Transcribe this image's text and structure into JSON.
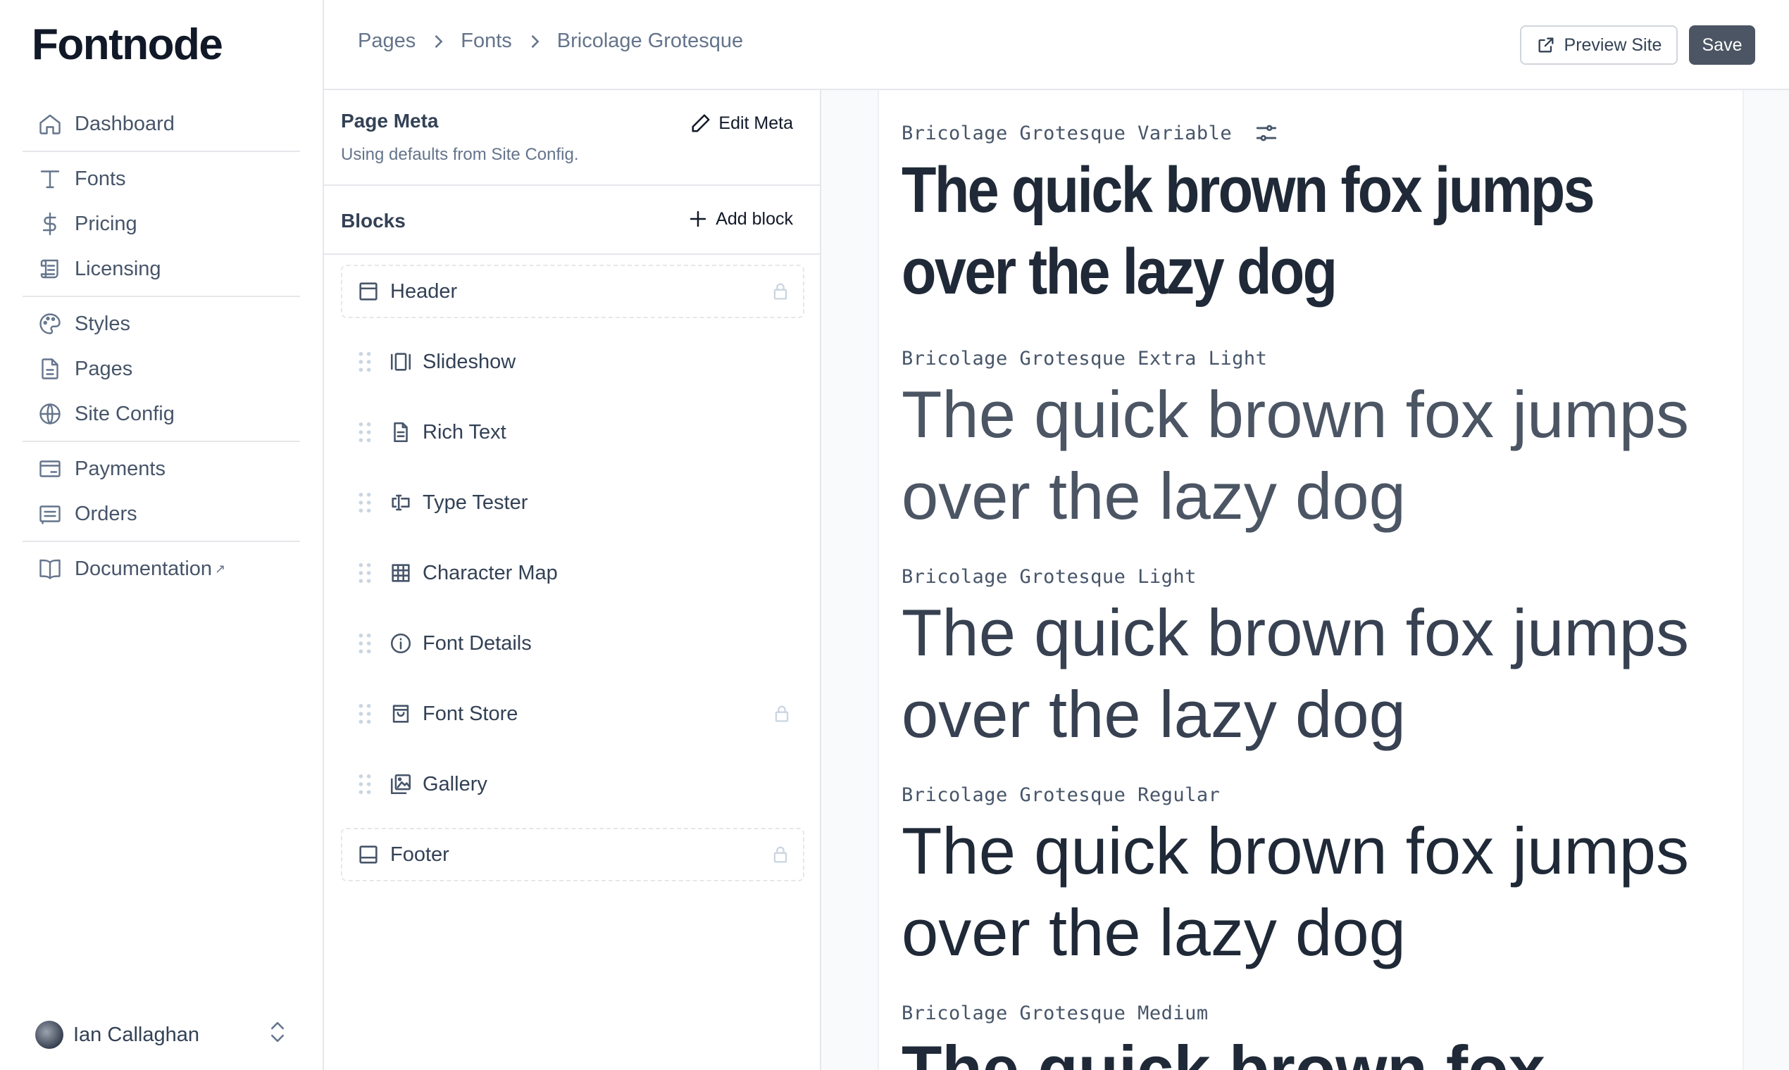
{
  "app": {
    "logo": "Fontnode"
  },
  "sidebar": {
    "groups": [
      [
        {
          "label": "Dashboard",
          "icon": "home-icon"
        }
      ],
      [
        {
          "label": "Fonts",
          "icon": "type-icon"
        },
        {
          "label": "Pricing",
          "icon": "dollar-icon"
        },
        {
          "label": "Licensing",
          "icon": "scroll-icon"
        }
      ],
      [
        {
          "label": "Styles",
          "icon": "palette-icon"
        },
        {
          "label": "Pages",
          "icon": "file-icon"
        },
        {
          "label": "Site Config",
          "icon": "globe-icon"
        }
      ],
      [
        {
          "label": "Payments",
          "icon": "card-icon"
        },
        {
          "label": "Orders",
          "icon": "receipt-icon"
        }
      ],
      [
        {
          "label": "Documentation",
          "icon": "book-icon",
          "external": "↗"
        }
      ]
    ],
    "user": {
      "name": "Ian Callaghan"
    }
  },
  "topbar": {
    "breadcrumb": [
      "Pages",
      "Fonts",
      "Bricolage Grotesque"
    ],
    "preview_label": "Preview Site",
    "save_label": "Save"
  },
  "panel": {
    "meta_title": "Page Meta",
    "meta_sub": "Using defaults from Site Config.",
    "edit_meta_label": "Edit Meta",
    "blocks_title": "Blocks",
    "add_block_label": "Add block",
    "blocks": [
      {
        "label": "Header",
        "icon": "panel-top-icon",
        "locked": true
      },
      {
        "label": "Slideshow",
        "icon": "slides-icon",
        "locked": false
      },
      {
        "label": "Rich Text",
        "icon": "document-icon",
        "locked": false
      },
      {
        "label": "Type Tester",
        "icon": "text-cursor-icon",
        "locked": false
      },
      {
        "label": "Character Map",
        "icon": "grid-icon",
        "locked": false
      },
      {
        "label": "Font Details",
        "icon": "info-icon",
        "locked": false
      },
      {
        "label": "Font Store",
        "icon": "shopping-bag-icon",
        "locked": false,
        "lock_icon": true
      },
      {
        "label": "Gallery",
        "icon": "gallery-icon",
        "locked": false
      },
      {
        "label": "Footer",
        "icon": "panel-bottom-icon",
        "locked": true
      }
    ]
  },
  "preview": {
    "specimens": [
      {
        "label": "Bricolage Grotesque Variable",
        "text": "The quick brown fox jumps over the lazy dog",
        "has_settings": true
      },
      {
        "label": "Bricolage Grotesque Extra Light",
        "text": "The quick brown fox jumps over the lazy dog"
      },
      {
        "label": "Bricolage Grotesque Light",
        "text": "The quick brown fox jumps over the lazy dog"
      },
      {
        "label": "Bricolage Grotesque Regular",
        "text": "The quick brown fox jumps over the lazy dog"
      },
      {
        "label": "Bricolage Grotesque Medium",
        "text": "The quick brown fox"
      }
    ]
  }
}
